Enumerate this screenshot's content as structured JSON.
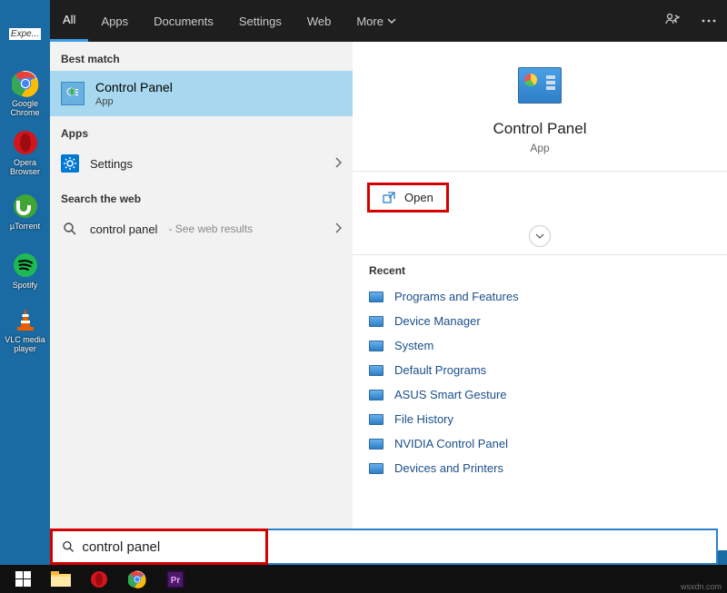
{
  "desktop": {
    "items": [
      {
        "label": "Expe..."
      },
      {
        "label": "Google Chrome"
      },
      {
        "label": "Opera Browser"
      },
      {
        "label": "µTorrent"
      },
      {
        "label": "Spotify"
      },
      {
        "label": "VLC media player"
      }
    ]
  },
  "tabs": {
    "items": [
      "All",
      "Apps",
      "Documents",
      "Settings",
      "Web",
      "More"
    ]
  },
  "left": {
    "best_match_header": "Best match",
    "best_match": {
      "title": "Control Panel",
      "subtitle": "App"
    },
    "apps_header": "Apps",
    "settings_label": "Settings",
    "search_web_header": "Search the web",
    "web_query": "control panel",
    "web_hint": "- See web results"
  },
  "detail": {
    "title": "Control Panel",
    "subtitle": "App",
    "open_label": "Open",
    "recent_header": "Recent",
    "recent": [
      "Programs and Features",
      "Device Manager",
      "System",
      "Default Programs",
      "ASUS Smart Gesture",
      "File History",
      "NVIDIA Control Panel",
      "Devices and Printers"
    ]
  },
  "search": {
    "query": "control panel"
  },
  "watermark": "wsxdn.com"
}
